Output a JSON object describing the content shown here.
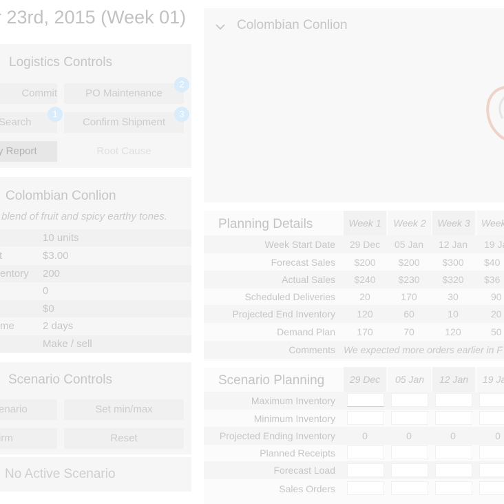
{
  "page": {
    "title": "er 23rd, 2015 (Week 01)"
  },
  "logistics": {
    "title": "Logistics Controls",
    "buttons": {
      "commit": "Commit",
      "po_maintenance": "PO Maintenance",
      "search": "Search",
      "confirm_shipment": "Confirm Shipment",
      "report": "y Report",
      "root_cause": "Root Cause"
    },
    "badges": {
      "one": "1",
      "two": "2",
      "three": "3"
    }
  },
  "product": {
    "name": "Colombian Conlion",
    "description": "blend of fruit and spicy earthy tones.",
    "attributes": [
      {
        "label": "",
        "value": "10 units"
      },
      {
        "label": "t",
        "value": "$3.00"
      },
      {
        "label": "entory",
        "value": "200"
      },
      {
        "label": "",
        "value": "0"
      },
      {
        "label": "",
        "value": "$0"
      },
      {
        "label": "me",
        "value": "2 days"
      },
      {
        "label": "",
        "value": "Make / sell"
      }
    ]
  },
  "scenario_controls": {
    "title": "Scenario Controls",
    "buttons": {
      "scenario": "enario",
      "set_min_max": "Set min/max",
      "confirm": "irm",
      "reset": "Reset"
    },
    "status": "No Active Scenario"
  },
  "product_header": {
    "name": "Colombian Conlion"
  },
  "planning": {
    "title": "Planning Details",
    "columns": [
      "Week 1",
      "Week 2",
      "Week 3",
      "Week"
    ],
    "rows": [
      {
        "label": "Week Start Date",
        "cells": [
          "29 Dec",
          "05 Jan",
          "12 Jan",
          "19 Ja"
        ]
      },
      {
        "label": "Forecast Sales",
        "cells": [
          "$200",
          "$200",
          "$300",
          "$40"
        ]
      },
      {
        "label": "Actual Sales",
        "cells": [
          "$240",
          "$230",
          "$320",
          "$36"
        ]
      },
      {
        "label": "Scheduled Deliveries",
        "cells": [
          "20",
          "170",
          "30",
          "90"
        ]
      },
      {
        "label": "Projected End Inventory",
        "cells": [
          "120",
          "60",
          "10",
          "20"
        ]
      },
      {
        "label": "Demand Plan",
        "cells": [
          "170",
          "70",
          "120",
          "50"
        ]
      }
    ],
    "comments_label": "Comments",
    "comment": "We expected more orders earlier in F"
  },
  "scenario_planning": {
    "title": "Scenario Planning",
    "columns": [
      "29 Dec",
      "05 Jan",
      "12 Jan",
      "19 Ja"
    ],
    "rows": [
      {
        "label": "Maximum Inventory"
      },
      {
        "label": "Minimum Inventory"
      },
      {
        "label": "Projected Ending Inventory",
        "cells": [
          "0",
          "0",
          "0",
          "0"
        ]
      },
      {
        "label": "Planned Receipts"
      },
      {
        "label": "Forecast Load"
      },
      {
        "label": "Sales Orders"
      }
    ]
  },
  "colors": {
    "badge": "#d8ecfb",
    "logo_stroke": "#efd3c8"
  }
}
